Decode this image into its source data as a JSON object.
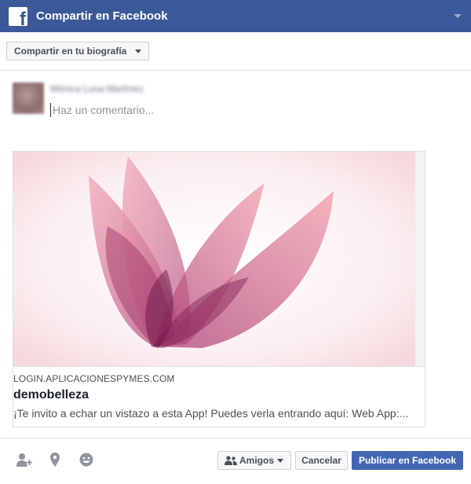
{
  "dialog": {
    "title": "Compartir en Facebook",
    "logo_glyph": "f",
    "brand_color": "#3b5998"
  },
  "share_target": {
    "label": "Compartir en tu biografía"
  },
  "composer": {
    "user_name": "Mónica Luna Martínez",
    "comment_placeholder": "Haz un comentario...",
    "comment_value": ""
  },
  "link_card": {
    "domain": "LOGIN.APLICACIONESPYMES.COM",
    "title": "demobelleza",
    "description": "¡Te invito a echar un vistazo a esta App! Puedes verla entrando aquí: Web App:...",
    "image_icon": "lotus-flower-logo"
  },
  "footer": {
    "icons": [
      "tag-friends-icon",
      "location-pin-icon",
      "feeling-smiley-icon"
    ],
    "audience_label": "Amigos",
    "cancel_label": "Cancelar",
    "publish_label": "Publicar en Facebook",
    "publish_color": "#4267b2"
  }
}
